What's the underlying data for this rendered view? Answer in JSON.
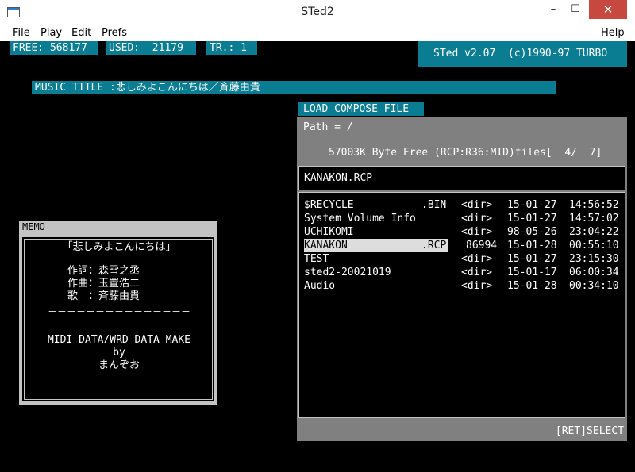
{
  "window": {
    "title": "STed2",
    "minimize_glyph": "–",
    "maximize_glyph": "☐",
    "close_glyph": "✕"
  },
  "menu": {
    "file": "File",
    "play": "Play",
    "edit": "Edit",
    "prefs": "Prefs",
    "help": "Help"
  },
  "status": {
    "free": "FREE: 568177",
    "used": "USED:  21179",
    "track": "TR.: 1",
    "version": "STed v2.07  (c)1990-97 TURBO"
  },
  "music_title": "MUSIC TITLE :悲しみよこんにちは／斉藤由貴",
  "memo": {
    "header": "MEMO",
    "lines": [
      "「悲しみよこんにちは」",
      "作詞：森雪之丞",
      "作曲：玉置浩二",
      "歌　：斉藤由貴",
      "－－－－－－－－－－－－－－－",
      "MIDI DATA/WRD DATA MAKE",
      "by",
      "まんぞお"
    ]
  },
  "dialog": {
    "header": "LOAD COMPOSE FILE",
    "path": "Path = /",
    "free_info": "57003K Byte Free (RCP:R36:MID)files[  4/  7]",
    "selected_file": "KANAKON.RCP",
    "files": [
      {
        "name": "$RECYCLE",
        "ext": ".BIN",
        "size": "<dir>",
        "date": "15-01-27",
        "time": "14:56:52"
      },
      {
        "name": "System Volume Info",
        "ext": "",
        "size": "<dir>",
        "date": "15-01-27",
        "time": "14:57:02"
      },
      {
        "name": "UCHIKOMI",
        "ext": "",
        "size": "<dir>",
        "date": "98-05-26",
        "time": "23:04:22"
      },
      {
        "name": "KANAKON",
        "ext": ".RCP",
        "size": "86994",
        "date": "15-01-28",
        "time": "00:55:10"
      },
      {
        "name": "TEST",
        "ext": "",
        "size": "<dir>",
        "date": "15-01-27",
        "time": "23:15:30"
      },
      {
        "name": "sted2-20021019",
        "ext": "",
        "size": "<dir>",
        "date": "15-01-17",
        "time": "06:00:34"
      },
      {
        "name": "Audio",
        "ext": "",
        "size": "<dir>",
        "date": "15-01-28",
        "time": "00:34:10"
      }
    ],
    "highlighted_index": 3,
    "footer": "[RET]SELECT"
  },
  "colors": {
    "accent": "#0b7d92",
    "panel": "#808080",
    "frame": "#c3c3c3",
    "close": "#c7483f"
  }
}
